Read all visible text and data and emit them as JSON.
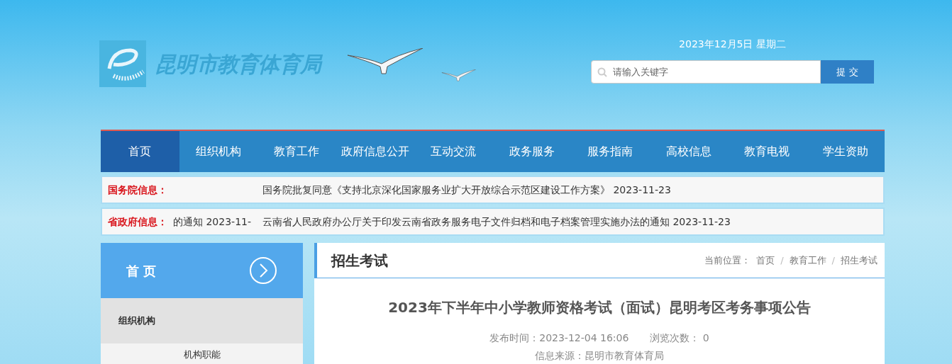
{
  "header": {
    "logo_text": "昆明市教育体育局",
    "date": "2023年12月5日 星期二",
    "search": {
      "placeholder": "请输入关键字",
      "button": "提 交"
    }
  },
  "nav": [
    {
      "label": "首页",
      "selected": true
    },
    {
      "label": "组织机构",
      "selected": false
    },
    {
      "label": "教育工作",
      "selected": false
    },
    {
      "label": "政府信息公开",
      "selected": false
    },
    {
      "label": "互动交流",
      "selected": false
    },
    {
      "label": "政务服务",
      "selected": false
    },
    {
      "label": "服务指南",
      "selected": false
    },
    {
      "label": "高校信息",
      "selected": false
    },
    {
      "label": "教育电视",
      "selected": false
    },
    {
      "label": "学生资助",
      "selected": false
    }
  ],
  "tickers": [
    {
      "label": "国务院信息：",
      "items": [
        "国务院批复同意《支持北京深化国家服务业扩大开放综合示范区建设工作方案》 2023-11-23"
      ]
    },
    {
      "label": "省政府信息：",
      "items": [
        "的通知 2023-11-",
        "云南省人民政府办公厅关于印发云南省政务服务电子文件归档和电子档案管理实施办法的通知 2023-11-23"
      ]
    }
  ],
  "sidebar": {
    "title": "首 页",
    "items": [
      {
        "label": "组织机构",
        "kind": "heading"
      },
      {
        "label": "机构职能",
        "kind": "link"
      }
    ]
  },
  "main": {
    "section": "招生考试",
    "breadcrumb": {
      "label": "当前位置：",
      "items": [
        "首页",
        "教育工作",
        "招生考试"
      ],
      "separator": "/"
    },
    "article": {
      "title": "2023年下半年中小学教师资格考试（面试）昆明考区考务事项公告",
      "published_label": "发布时间：",
      "published": "2023-12-04 16:06",
      "views_label": "浏览次数：",
      "views": "0",
      "source_label": "信息来源：",
      "source": "昆明市教育体育局"
    }
  }
}
